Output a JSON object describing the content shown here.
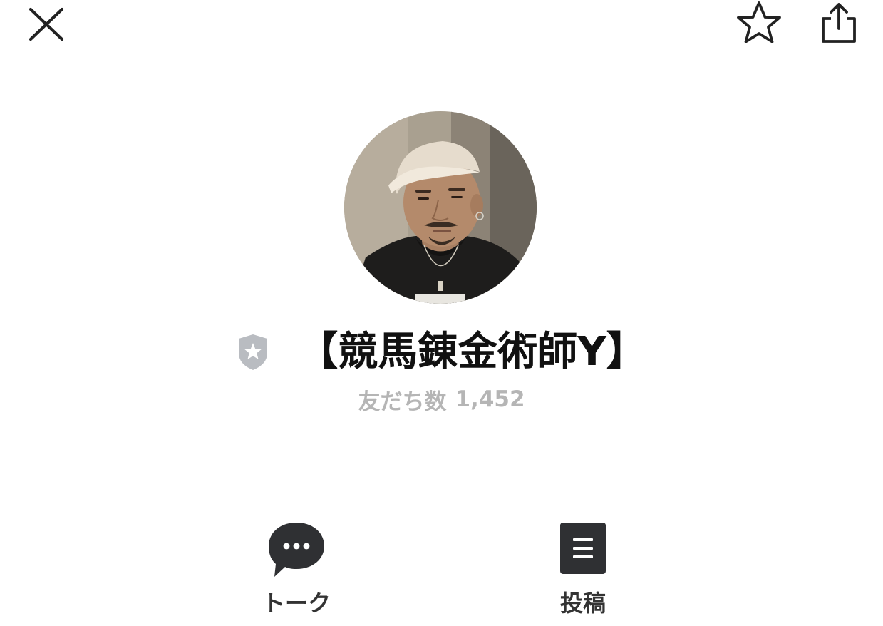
{
  "header": {
    "close_icon": "close-icon",
    "favorite_icon": "star-outline-icon",
    "share_icon": "share-icon"
  },
  "profile": {
    "name": "【競馬錬金術師Y】",
    "badge_icon": "verified-shield-icon",
    "friends_label": "友だち数",
    "friends_count": "1,452"
  },
  "actions": [
    {
      "label": "トーク",
      "icon": "chat-bubble-icon"
    },
    {
      "label": "投稿",
      "icon": "post-document-icon"
    }
  ],
  "colors": {
    "text_primary": "#111111",
    "text_muted": "#b5b5b5",
    "icon_dark": "#2f3033",
    "badge_gray": "#b9bcc1"
  }
}
